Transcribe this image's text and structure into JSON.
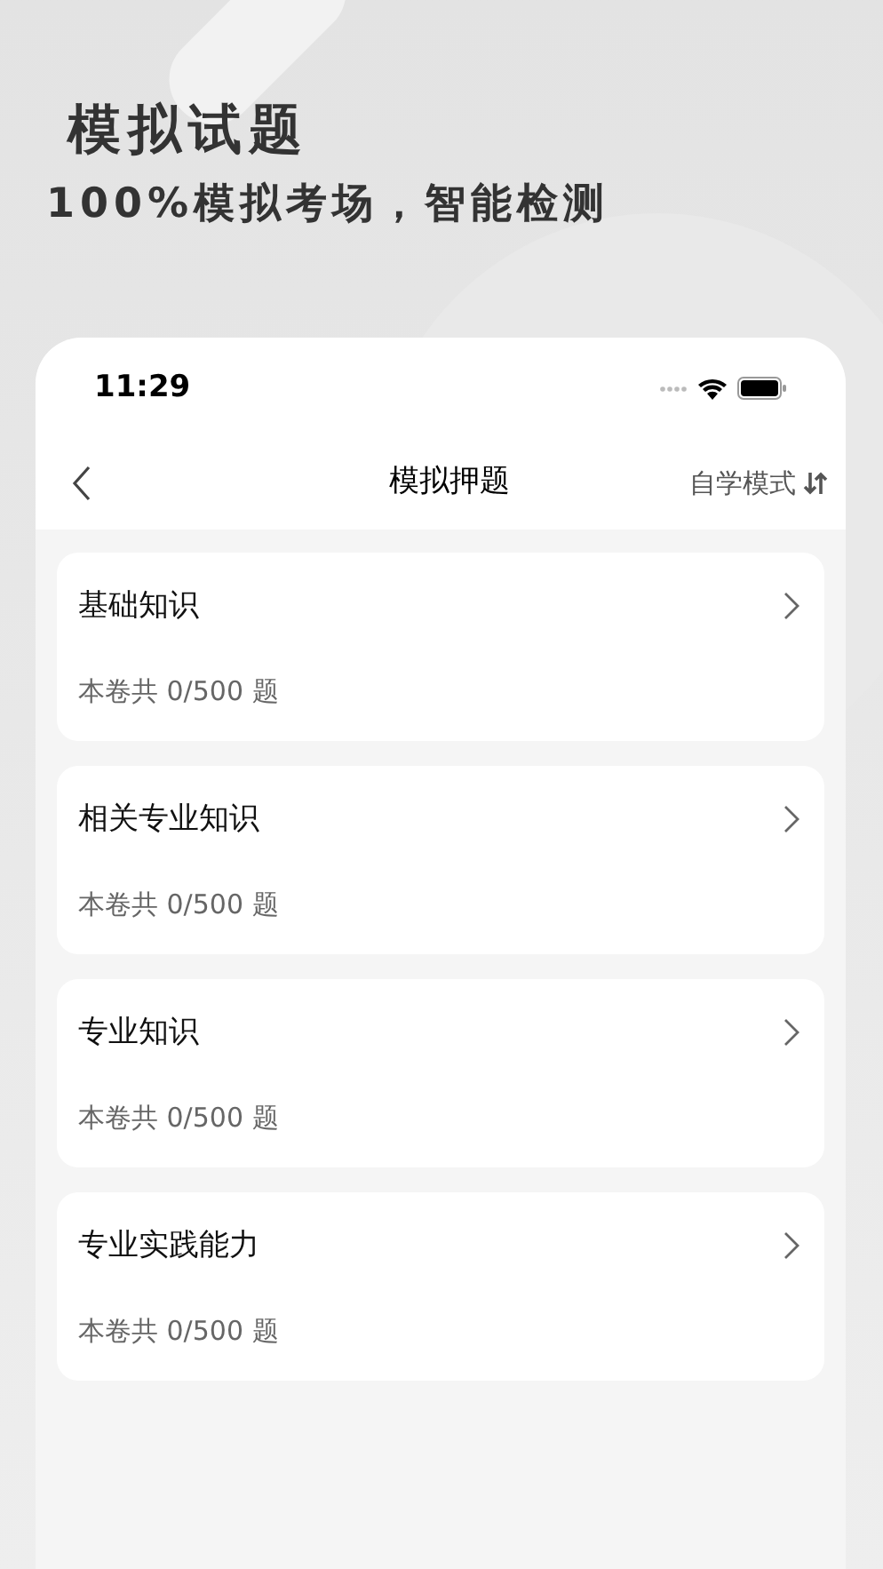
{
  "hero": {
    "title": "模拟试题",
    "subtitle": "100%模拟考场，智能检测"
  },
  "status_bar": {
    "time": "11:29"
  },
  "nav": {
    "title": "模拟押题",
    "mode": "自学模式"
  },
  "papers": [
    {
      "title": "基础知识",
      "count": "本卷共 0/500 题"
    },
    {
      "title": "相关专业知识",
      "count": "本卷共 0/500 题"
    },
    {
      "title": "专业知识",
      "count": "本卷共 0/500 题"
    },
    {
      "title": "专业实践能力",
      "count": "本卷共 0/500 题"
    }
  ]
}
